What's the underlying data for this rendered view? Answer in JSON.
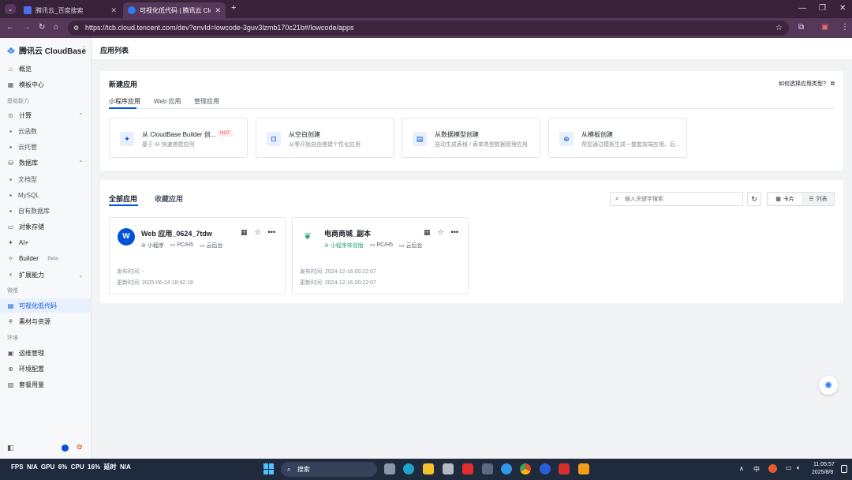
{
  "browser": {
    "tabs": [
      {
        "label": "腾讯云_百度搜索",
        "active": false
      },
      {
        "label": "可视化低代码 | 腾讯云 Cloud...",
        "active": true
      }
    ],
    "new_tab": "+",
    "url": "https://tcb.cloud.tencent.com/dev?envId=lowcode-3guv3lzmb170c21b#/lowcode/apps"
  },
  "sidebar": {
    "brand": "腾讯云 CloudBase",
    "items": [
      {
        "type": "nav",
        "label": "概览",
        "icon": "home-icon"
      },
      {
        "type": "nav",
        "label": "模板中心",
        "icon": "grid-icon"
      },
      {
        "type": "section",
        "label": "基础能力"
      },
      {
        "type": "nav",
        "label": "计算",
        "icon": "compute-icon",
        "chevron": "up"
      },
      {
        "type": "sub",
        "label": "云函数"
      },
      {
        "type": "sub",
        "label": "云托管"
      },
      {
        "type": "nav",
        "label": "数据库",
        "icon": "database-icon",
        "chevron": "up"
      },
      {
        "type": "sub",
        "label": "文档型"
      },
      {
        "type": "sub",
        "label": "MySQL"
      },
      {
        "type": "sub",
        "label": "自有数据库"
      },
      {
        "type": "nav",
        "label": "对象存储",
        "icon": "folder-icon"
      },
      {
        "type": "nav",
        "label": "AI+",
        "icon": "ai-icon"
      },
      {
        "type": "nav",
        "label": "Builder",
        "icon": "builder-icon",
        "badge": "Beta"
      },
      {
        "type": "nav",
        "label": "扩展能力",
        "icon": "extension-icon",
        "chevron": "down"
      },
      {
        "type": "section",
        "label": "微搭"
      },
      {
        "type": "nav",
        "label": "可视化低代码",
        "icon": "lowcode-icon",
        "selected": true
      },
      {
        "type": "nav",
        "label": "素材与资源",
        "icon": "assets-icon"
      },
      {
        "type": "section",
        "label": "环境"
      },
      {
        "type": "nav",
        "label": "运维管理",
        "icon": "ops-icon"
      },
      {
        "type": "nav",
        "label": "环境配置",
        "icon": "settings-icon"
      },
      {
        "type": "nav",
        "label": "套餐用量",
        "icon": "package-icon"
      }
    ]
  },
  "page": {
    "title": "应用列表"
  },
  "create_section": {
    "title": "新建应用",
    "help_link": "如何选择应用类型?",
    "tabs": [
      "小程序应用",
      "Web 应用",
      "管理应用"
    ],
    "options": [
      {
        "title": "从 CloudBase Builder 创...",
        "desc": "基于 AI 快速搭建应用",
        "hot": "HOT"
      },
      {
        "title": "从空白创建",
        "desc": "从零开始自由搭建个性化应用"
      },
      {
        "title": "从数据模型创建",
        "desc": "自动生成表格 / 表单类型数据管理应用"
      },
      {
        "title": "从模板创建",
        "desc": "帮您通过模板生成一整套前端应用、后..."
      }
    ]
  },
  "apps_section": {
    "tabs": [
      "全部应用",
      "收藏应用"
    ],
    "search_placeholder": "输入关键字搜索",
    "view_card": "卡片",
    "view_list": "列表",
    "apps": [
      {
        "avatar": "W",
        "name": "Web 应用_0624_7tdw",
        "tags": [
          "小程序",
          "PC/H5",
          "云后台"
        ],
        "published": "发布时间: -",
        "updated": "更新时间: 2025-06-24 18:42:18"
      },
      {
        "name": "电商商城_副本",
        "tags": [
          "小程序体验版",
          "PC/H5",
          "云后台"
        ],
        "published": "发布时间: 2024-12-16 00:22:07",
        "updated": "更新时间: 2024-12-16 00:22:07"
      }
    ]
  },
  "taskbar": {
    "perf": "FPS  N/A  GPU  6%  CPU  16%  延时  N/A",
    "search": "搜索",
    "ime": "中",
    "time": "11:05:57",
    "date": "2025/8/8"
  }
}
